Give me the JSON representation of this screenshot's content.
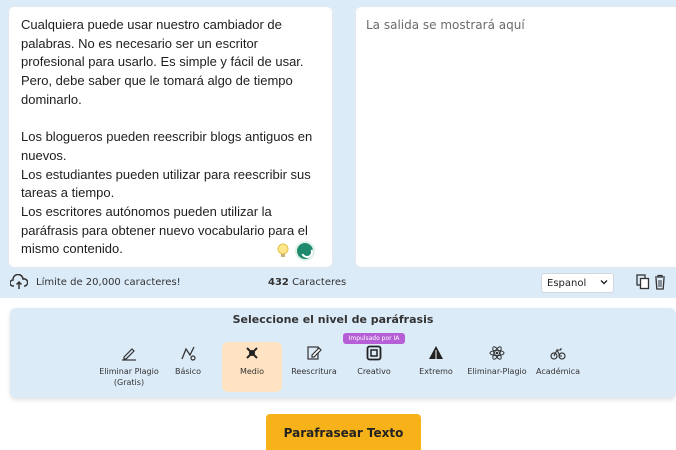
{
  "input": {
    "text": "Cualquiera puede usar nuestro cambiador de palabras. No es necesario ser un escritor profesional para usarlo. Es simple y fácil de usar. Pero, debe saber que le tomará algo de tiempo dominarlo.\n\nLos blogueros pueden reescribir blogs antiguos en nuevos.\nLos estudiantes pueden utilizar para reescribir sus tareas a tiempo.\nLos escritores autónomos pueden utilizar la paráfrasis para obtener nuevo vocabulario para el mismo contenido."
  },
  "output": {
    "placeholder": "La salida se mostrará aquí"
  },
  "bottom_bar": {
    "limit_text": "Límite de 20,000 caracteres!",
    "char_count": "432",
    "char_label": "Caracteres",
    "language": "Espanol"
  },
  "modes": {
    "title": "Seleccione el nivel de paráfrasis",
    "ai_badge": "Impulsado por IA",
    "items": [
      {
        "label": "Eliminar Plagio\n(Gratis)",
        "icon": "pen-icon"
      },
      {
        "label": "Básico",
        "icon": "basic-icon"
      },
      {
        "label": "Medio",
        "icon": "medium-icon",
        "active": true
      },
      {
        "label": "Reescritura",
        "icon": "rewrite-icon"
      },
      {
        "label": "Creativo",
        "icon": "creative-icon"
      },
      {
        "label": "Extremo",
        "icon": "extreme-icon"
      },
      {
        "label": "Eliminar-Plagio",
        "icon": "atom-icon"
      },
      {
        "label": "Académica",
        "icon": "bicycle-icon"
      }
    ]
  },
  "cta": {
    "label": "Parafrasear Texto"
  },
  "colors": {
    "panel_bg": "#dcebf8",
    "active_mode": "#ffe3c2",
    "cta": "#f7b21a",
    "ai_badge": "#b55ed6"
  }
}
